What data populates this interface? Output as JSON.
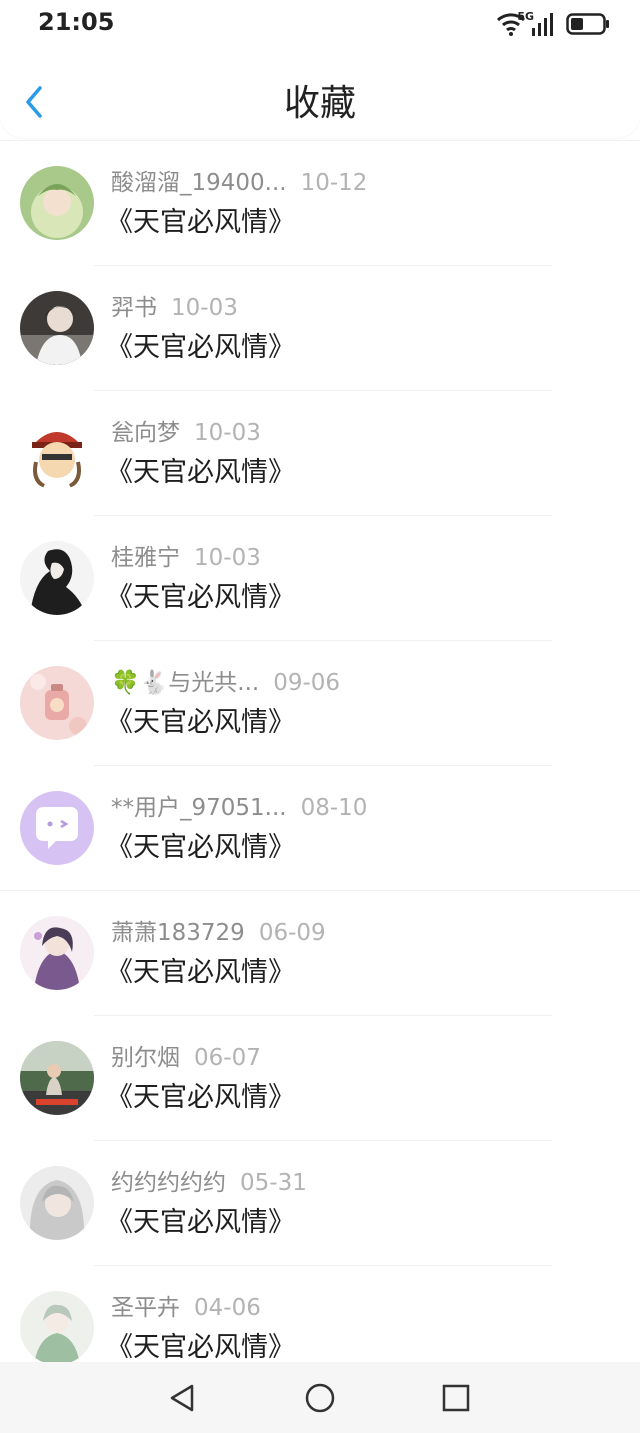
{
  "status_bar": {
    "time": "21:05",
    "network": "5G",
    "icons": [
      "wifi-icon",
      "signal-5g-icon",
      "battery-icon"
    ]
  },
  "header": {
    "title": "收藏",
    "back_icon": "back-arrow-icon",
    "accent_color": "#2a9be8"
  },
  "items": [
    {
      "name": "酸溜溜_19400...",
      "date": "10-12",
      "title": "《天官必风情》",
      "avatar": "anime-green-haired-avatar"
    },
    {
      "name": "羿书",
      "date": "10-03",
      "title": "《天官必风情》",
      "avatar": "person-dark-hair-avatar"
    },
    {
      "name": "瓮向梦",
      "date": "10-03",
      "title": "《天官必风情》",
      "avatar": "cartoon-pirate-avatar"
    },
    {
      "name": "桂雅宁",
      "date": "10-03",
      "title": "《天官必风情》",
      "avatar": "sketch-portrait-avatar"
    },
    {
      "name": "🍀🐇与光共...",
      "date": "09-06",
      "title": "《天官必风情》",
      "avatar": "pink-charm-avatar"
    },
    {
      "name": "**用户_97051...",
      "date": "08-10",
      "title": "《天官必风情》",
      "avatar": "default-chat-bubble-avatar"
    },
    {
      "name": "萧萧183729",
      "date": "06-09",
      "title": "《天官必风情》",
      "avatar": "anime-purple-avatar"
    },
    {
      "name": "别尔烟",
      "date": "06-07",
      "title": "《天官必风情》",
      "avatar": "outdoor-photo-avatar"
    },
    {
      "name": "约约约约约",
      "date": "05-31",
      "title": "《天官必风情》",
      "avatar": "anime-silver-haired-avatar"
    },
    {
      "name": "圣平卉",
      "date": "04-06",
      "title": "《天官必风情》",
      "avatar": "anime-green-figure-avatar"
    }
  ],
  "nav_bar": {
    "icons": [
      "nav-back-triangle-icon",
      "nav-home-circle-icon",
      "nav-recents-square-icon"
    ]
  }
}
